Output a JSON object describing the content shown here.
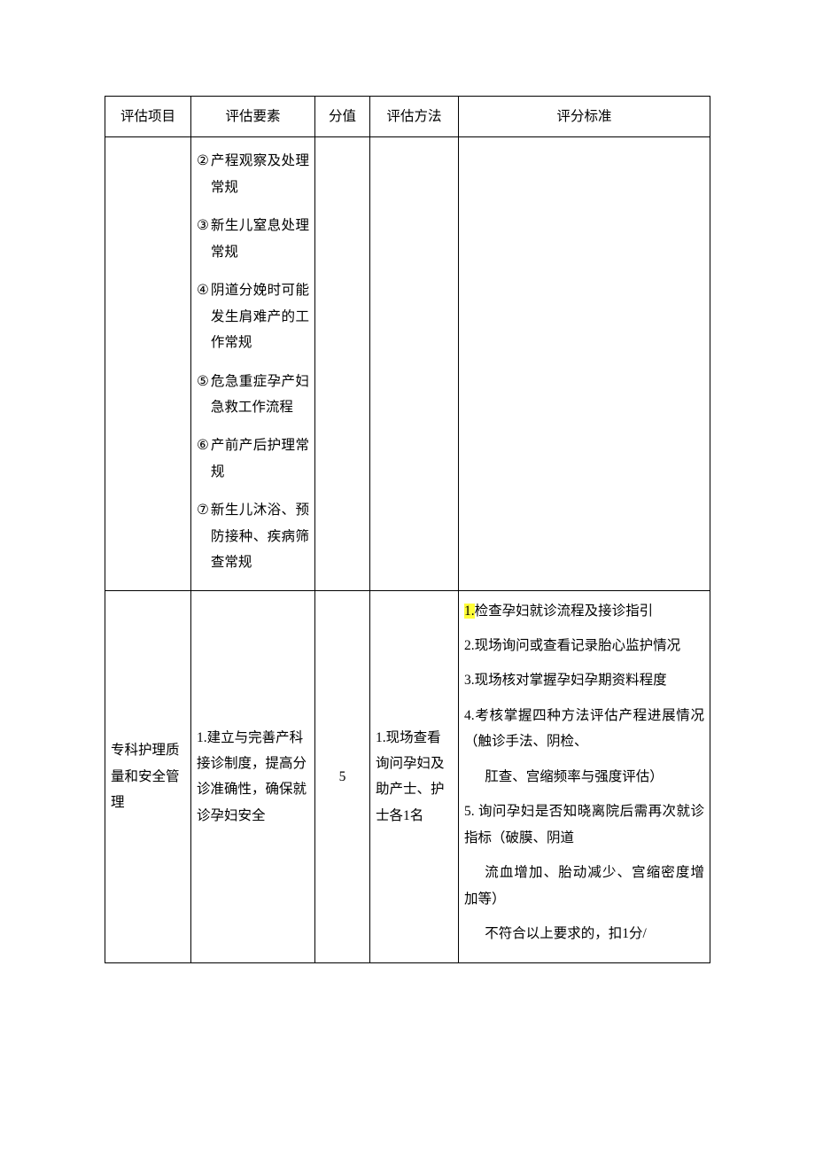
{
  "headers": {
    "project": "评估项目",
    "element": "评估要素",
    "score": "分值",
    "method": "评估方法",
    "standard": "评分标准"
  },
  "row1": {
    "project": "",
    "elements": {
      "m2": "②",
      "t2": "产程观察及处理常规",
      "m3": "③",
      "t3": "新生儿窒息处理常规",
      "m4": "④",
      "t4": "阴道分娩时可能发生肩难产的工作常规",
      "m5": "⑤",
      "t5": "危急重症孕产妇急救工作流程",
      "m6": "⑥",
      "t6": "产前产后护理常规",
      "m7": "⑦",
      "t7": "新生儿沐浴、预防接种、疾病筛查常规"
    },
    "score": "",
    "method": "",
    "standard": ""
  },
  "row2": {
    "project": "专科护理质量和安全管理",
    "element": "1.建立与完善产科接诊制度，提高分诊准确性，确保就诊孕妇安全",
    "score": "5",
    "method": "1.现场查看询问孕妇及助产士、护士各1名",
    "standard": {
      "p1_hl": "1.",
      "p1": "检查孕妇就诊流程及接诊指引",
      "p2": "2.现场询问或查看记录胎心监护情况",
      "p3": "3.现场核对掌握孕妇孕期资料程度",
      "p4": "4.考核掌握四种方法评估产程进展情况（触诊手法、阴检、",
      "p4b": "肛查、宫缩频率与强度评估）",
      "p5": "5. 询问孕妇是否知晓离院后需再次就诊指标（破膜、阴道",
      "p5b": "流血增加、胎动减少、宫缩密度增加等）",
      "p6": "不符合以上要求的，扣1分/"
    }
  }
}
